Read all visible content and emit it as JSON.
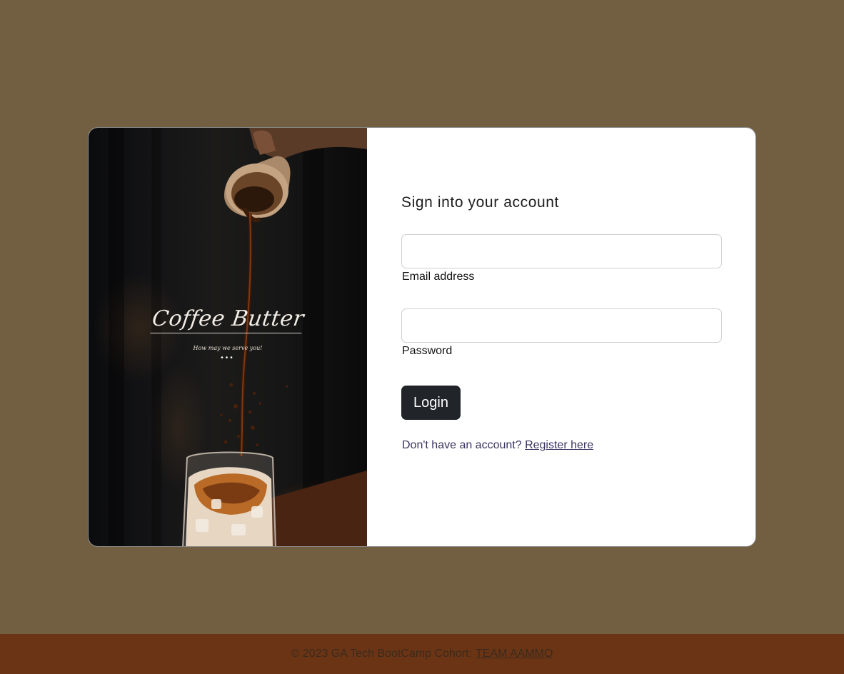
{
  "hero": {
    "brand_name": "Coffee Butter",
    "tagline": "How may we serve you!",
    "dots": "•••"
  },
  "form": {
    "title": "Sign into your account",
    "email": {
      "label": "Email address",
      "value": "",
      "placeholder": ""
    },
    "password": {
      "label": "Password",
      "value": "",
      "placeholder": ""
    },
    "login_label": "Login",
    "register_prompt": "Don't have an account?",
    "register_link": "Register here"
  },
  "footer": {
    "text": "© 2023 GA Tech BootCamp Cohort:",
    "link": "TEAM AAMMO"
  },
  "colors": {
    "page_background": "#725f41",
    "card_background": "#ffffff",
    "button_background": "#212529",
    "footer_background": "#6b3515",
    "link_color": "#3a3560"
  }
}
